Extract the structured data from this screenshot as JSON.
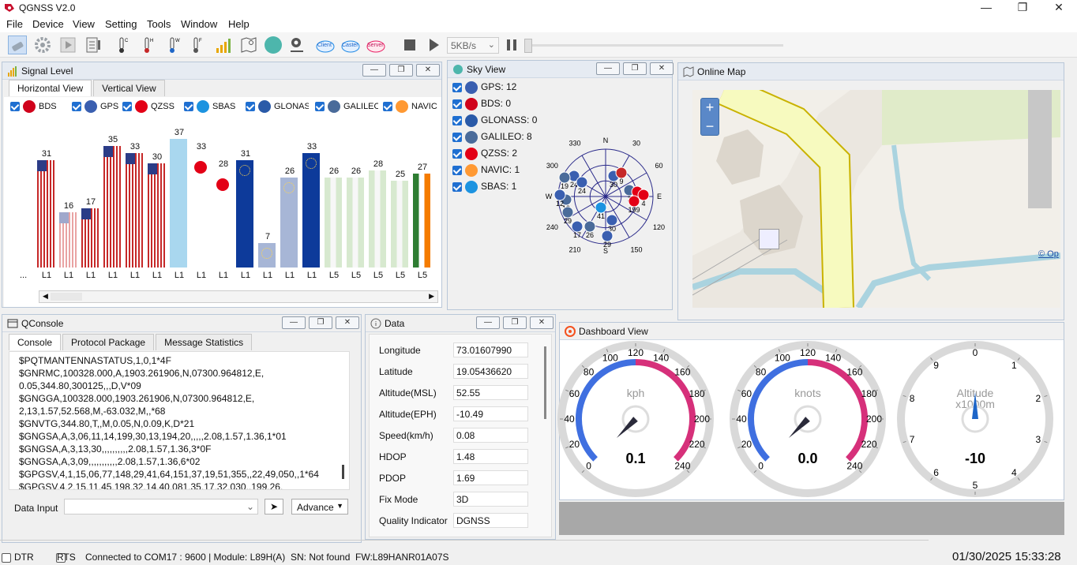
{
  "app": {
    "title": "QGNSS V2.0"
  },
  "menu": [
    "File",
    "Device",
    "View",
    "Setting",
    "Tools",
    "Window",
    "Help"
  ],
  "toolbar": {
    "baud": "5KB/s",
    "icon_names": [
      "connect-icon",
      "settings-icon",
      "play-icon",
      "logbook-icon",
      "thermo-c-icon",
      "thermo-h-icon",
      "thermo-w-icon",
      "thermo-f-icon",
      "signal-bars-icon",
      "map-icon",
      "globe-icon",
      "location-pin-icon",
      "client-icon",
      "caster-icon",
      "server-icon",
      "stop-icon",
      "run-icon",
      "pause-icon"
    ],
    "ntrip": [
      "Client",
      "Caster",
      "Server"
    ]
  },
  "signal": {
    "title": "Signal Level",
    "tabs": [
      "Horizontal View",
      "Vertical View"
    ],
    "legend": [
      {
        "name": "BDS",
        "color": "#d0021b"
      },
      {
        "name": "GPS",
        "color": "#3a5fb0"
      },
      {
        "name": "QZSS",
        "color": "#e30016"
      },
      {
        "name": "SBAS",
        "color": "#1c93e0"
      },
      {
        "name": "GLONASS",
        "color": "#2a5aa8"
      },
      {
        "name": "GALILEO",
        "color": "#4a6b9a"
      },
      {
        "name": "NAVIC",
        "color": "#ff9933"
      }
    ],
    "bars": [
      {
        "value": 31,
        "label": "L1",
        "kind": "gps"
      },
      {
        "value": 16,
        "label": "L1",
        "kind": "gps-light"
      },
      {
        "value": 17,
        "label": "L1",
        "kind": "gps"
      },
      {
        "value": 35,
        "label": "L1",
        "kind": "gps"
      },
      {
        "value": 33,
        "label": "L1",
        "kind": "gps"
      },
      {
        "value": 30,
        "label": "L1",
        "kind": "gps"
      },
      {
        "value": 37,
        "label": "L1",
        "kind": "sbas"
      },
      {
        "value": 33,
        "label": "L1",
        "kind": "qzss"
      },
      {
        "value": 28,
        "label": "L1",
        "kind": "qzss"
      },
      {
        "value": 31,
        "label": "L1",
        "kind": "gal"
      },
      {
        "value": 7,
        "label": "L1",
        "kind": "gal-light"
      },
      {
        "value": 26,
        "label": "L1",
        "kind": "gal-light"
      },
      {
        "value": 33,
        "label": "L1",
        "kind": "gal"
      },
      {
        "value": 26,
        "label": "L5",
        "kind": "navic-light"
      },
      {
        "value": 26,
        "label": "L5",
        "kind": "navic-light"
      },
      {
        "value": 28,
        "label": "L5",
        "kind": "navic-light"
      },
      {
        "value": 25,
        "label": "L5",
        "kind": "navic-light"
      },
      {
        "value": 27,
        "label": "L5",
        "kind": "navic"
      }
    ],
    "more": "..."
  },
  "sky": {
    "title": "Sky View",
    "items": [
      {
        "label": "GPS: 12",
        "color": "#3a5fb0"
      },
      {
        "label": "BDS: 0",
        "color": "#d0021b"
      },
      {
        "label": "GLONASS: 0",
        "color": "#2a5aa8"
      },
      {
        "label": "GALILEO: 8",
        "color": "#4a6b9a"
      },
      {
        "label": "QZSS: 2",
        "color": "#e30016"
      },
      {
        "label": "NAVIC: 1",
        "color": "#ff9933"
      },
      {
        "label": "SBAS: 1",
        "color": "#1c93e0"
      }
    ],
    "compass": [
      "N",
      "E",
      "S",
      "W"
    ],
    "azimuths": [
      "330",
      "30",
      "300",
      "60",
      "240",
      "120",
      "210",
      "150"
    ],
    "sat_labels": [
      "24",
      "19",
      "24",
      "30",
      "9",
      "19",
      "1",
      "2",
      "4",
      "12",
      "29",
      "41",
      "199",
      "17",
      "30",
      "26",
      "29"
    ]
  },
  "map": {
    "title": "Online Map",
    "zoom_in": "+",
    "zoom_out": "−",
    "attribution": "© Op"
  },
  "console": {
    "title": "QConsole",
    "tabs": [
      "Console",
      "Protocol Package",
      "Message Statistics"
    ],
    "lines": [
      "$PQTMANTENNASTATUS,1,0,1*4F",
      "$GNRMC,100328.000,A,1903.261906,N,07300.964812,E,",
      "0.05,344.80,300125,,,D,V*09",
      "$GNGGA,100328.000,1903.261906,N,07300.964812,E,",
      "2,13,1.57,52.568,M,-63.032,M,,*68",
      "$GNVTG,344.80,T,,M,0.05,N,0.09,K,D*21",
      "$GNGSA,A,3,06,11,14,199,30,13,194,20,,,,,2.08,1.57,1.36,1*01",
      "$GNGSA,A,3,13,30,,,,,,,,,,2.08,1.57,1.36,3*0F",
      "$GNGSA,A,3,09,,,,,,,,,,,2.08,1.57,1.36,6*02",
      "$GPGSV,4,1,15,06,77,148,29,41,64,151,37,19,51,355,,22,49,050,,1*64",
      "$GPGSV,4,2,15,11,45,198,32,14,40,081,35,17,32,030,,199,26,"
    ],
    "input_label": "Data Input",
    "input_value": "",
    "advance": "Advance"
  },
  "data": {
    "title": "Data",
    "rows": [
      {
        "label": "Longitude",
        "value": "73.01607990"
      },
      {
        "label": "Latitude",
        "value": "19.05436620"
      },
      {
        "label": "Altitude(MSL)",
        "value": "52.55"
      },
      {
        "label": "Altitude(EPH)",
        "value": "-10.49"
      },
      {
        "label": "Speed(km/h)",
        "value": "0.08"
      },
      {
        "label": "HDOP",
        "value": "1.48"
      },
      {
        "label": "PDOP",
        "value": "1.69"
      },
      {
        "label": "Fix Mode",
        "value": "3D"
      },
      {
        "label": "Quality Indicator",
        "value": "DGNSS"
      }
    ]
  },
  "dashboard": {
    "title": "Dashboard View",
    "gauges": [
      {
        "unit": "kph",
        "value": "0.1",
        "level": 0.0004,
        "ticks": [
          "0",
          "20",
          "40",
          "60",
          "80",
          "100",
          "120",
          "140",
          "160",
          "180",
          "200",
          "220",
          "240"
        ]
      },
      {
        "unit": "knots",
        "value": "0.0",
        "level": 0.0,
        "ticks": [
          "0",
          "20",
          "40",
          "60",
          "80",
          "100",
          "120",
          "140",
          "160",
          "180",
          "200",
          "220",
          "240"
        ]
      },
      {
        "unit": "Altitude",
        "unit2": "x1000m",
        "value": "-10",
        "level": 0.0,
        "ticks": [
          "0",
          "1",
          "2",
          "3",
          "4",
          "5",
          "6",
          "7",
          "8",
          "9"
        ]
      }
    ]
  },
  "status": {
    "dtr": "DTR",
    "rts": "RTS",
    "connection": "Connected to COM17 : 9600 | Module: L89H(A)",
    "sn": "SN: Not found",
    "fw": "FW:L89HANR01A07S",
    "datetime": "01/30/2025 15:33:28"
  }
}
